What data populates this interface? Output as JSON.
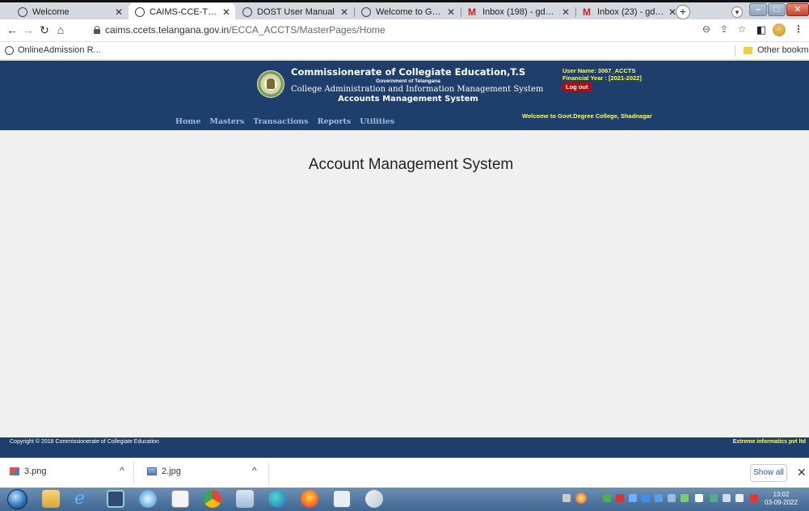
{
  "browser": {
    "tabs": [
      {
        "title": "Welcome",
        "active": false
      },
      {
        "title": "CAIMS-CCE-TS-IND",
        "active": true
      },
      {
        "title": "DOST User Manual",
        "active": false
      },
      {
        "title": "Welcome to Govt.Degree",
        "active": false
      },
      {
        "title": "Inbox (198) - gdc.shadnag",
        "active": false
      },
      {
        "title": "Inbox (23) - gdcsdnriqacl",
        "active": false
      }
    ],
    "url_host": "caims.ccets.telangana.gov.in",
    "url_path": "/ECCA_ACCTS/MasterPages/Home",
    "bookmark": "OnlineAdmission R...",
    "other_bookmarks": "Other bookmarks"
  },
  "header": {
    "title": "Commissionerate of Collegiate Education,T.S",
    "subtitle": "Government of Telangana",
    "system": "College Administration and Information Management System",
    "accounts": "Accounts Management System",
    "user_name": "User Name: 3067_ACCTS",
    "financial_year": "Financial Year : [2021-2022]",
    "logout": "Log out",
    "welcome": "Welcome to Govt.Degree College, Shadnagar",
    "nav": [
      "Home",
      "Masters",
      "Transactions",
      "Reports",
      "Utilities"
    ]
  },
  "main": {
    "title": "Account Management System"
  },
  "footer": {
    "copyright": "Copyright © 2018 Commissionerate of Collegiate Education",
    "vendor": "Extreme informatics pvt ltd"
  },
  "downloads": {
    "items": [
      {
        "name": "3.png"
      },
      {
        "name": "2.jpg"
      }
    ],
    "show_all": "Show all"
  },
  "taskbar": {
    "time": "13:02",
    "date": "03-09-2022"
  }
}
